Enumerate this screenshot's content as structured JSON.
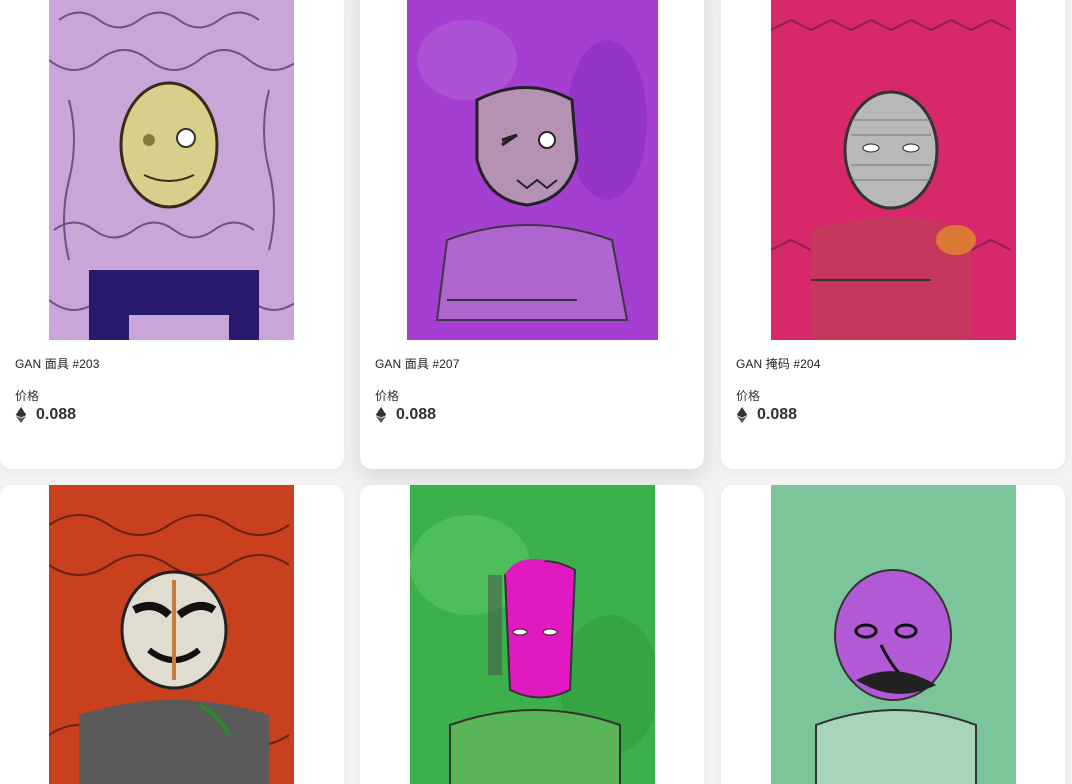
{
  "colors": {
    "page_bg": "#f3f3f4",
    "card_bg": "#ffffff",
    "text": "#222222"
  },
  "price_label": "价格",
  "currency_icon": "ethereum-icon",
  "cards": [
    {
      "name": "GAN 面具 #203",
      "price": "0.088",
      "bg": "#c9a6d8",
      "face": "#d8cf8a",
      "accent": "#2a1a6e"
    },
    {
      "name": "GAN 面具 #207",
      "price": "0.088",
      "bg": "#a43fd2",
      "face": "#b592b4",
      "accent": "#4a2a4a"
    },
    {
      "name": "GAN 掩码 #204",
      "price": "0.088",
      "bg": "#d6286a",
      "face": "#b8b8b8",
      "accent": "#4a1a2a"
    },
    {
      "name": "",
      "price": "",
      "bg": "#c8401e",
      "face": "#e0dcd0",
      "accent": "#2a1a10"
    },
    {
      "name": "",
      "price": "",
      "bg": "#3cb04a",
      "face": "#e01ac0",
      "accent": "#3a5a3a"
    },
    {
      "name": "",
      "price": "",
      "bg": "#7cc49a",
      "face": "#b25ad6",
      "accent": "#2a2a2a"
    }
  ]
}
